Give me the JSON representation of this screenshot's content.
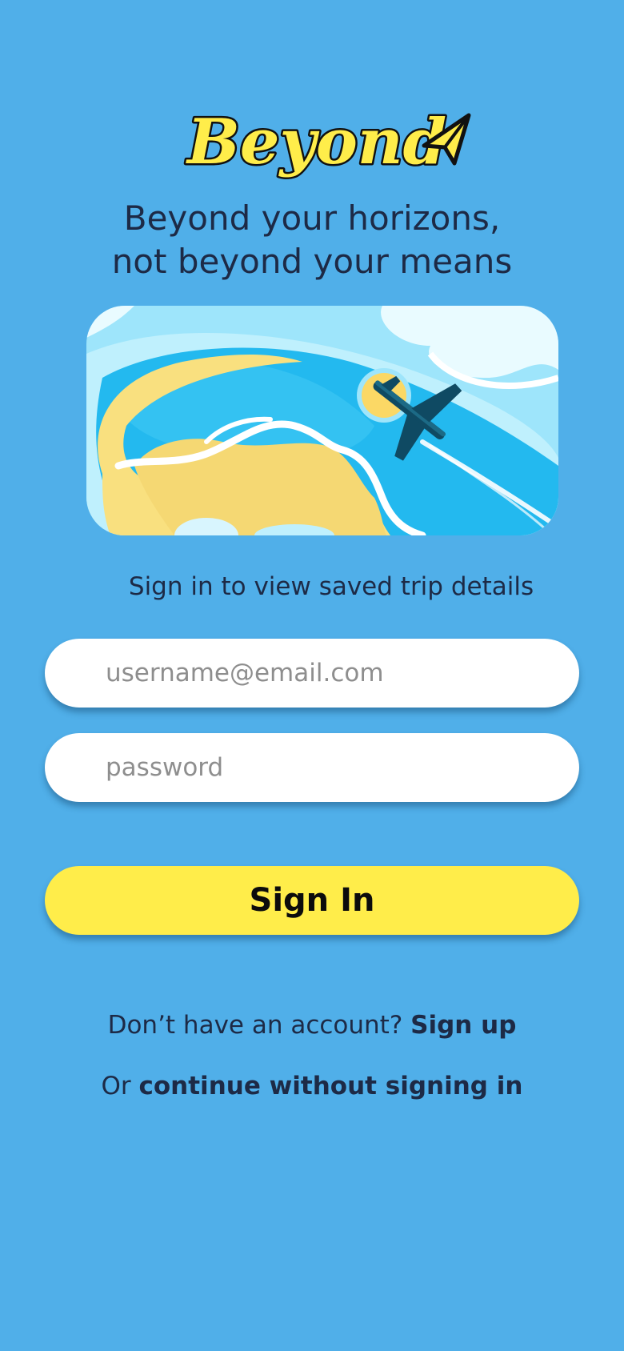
{
  "brand": {
    "logo_text": "Beyond",
    "tagline_line1": "Beyond your horizons,",
    "tagline_line2": "not beyond your means",
    "colors": {
      "background": "#50afe9",
      "logo_fill": "#ffed4a",
      "logo_outline": "#111111",
      "text": "#1d2a46",
      "button": "#ffed4a"
    }
  },
  "hero": {
    "icon": "airplane-over-beach-illustration"
  },
  "form": {
    "subtitle": "Sign in to view saved trip details",
    "email_placeholder": "username@email.com",
    "email_value": "",
    "password_placeholder": "password",
    "password_value": "",
    "submit_label": "Sign In"
  },
  "footer": {
    "signup_prompt": "Don’t have an account?",
    "signup_link": "Sign up",
    "guest_prefix": "Or",
    "guest_link": "continue without signing in"
  }
}
